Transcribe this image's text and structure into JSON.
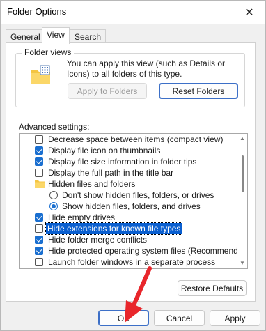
{
  "window": {
    "title": "Folder Options",
    "close_glyph": "✕"
  },
  "tabs": [
    {
      "label": "General",
      "active": false
    },
    {
      "label": "View",
      "active": true
    },
    {
      "label": "Search",
      "active": false
    }
  ],
  "folder_views": {
    "group_label": "Folder views",
    "description": "You can apply this view (such as Details or Icons) to all folders of this type.",
    "apply_button": "Apply to Folders",
    "reset_button": "Reset Folders"
  },
  "advanced": {
    "label": "Advanced settings:",
    "items": [
      {
        "type": "checkbox",
        "checked": false,
        "label": "Decrease space between items (compact view)"
      },
      {
        "type": "checkbox",
        "checked": true,
        "label": "Display file icon on thumbnails"
      },
      {
        "type": "checkbox",
        "checked": true,
        "label": "Display file size information in folder tips"
      },
      {
        "type": "checkbox",
        "checked": false,
        "label": "Display the full path in the title bar"
      },
      {
        "type": "folder",
        "label": "Hidden files and folders"
      },
      {
        "type": "radio",
        "checked": false,
        "label": "Don't show hidden files, folders, or drives"
      },
      {
        "type": "radio",
        "checked": true,
        "label": "Show hidden files, folders, and drives"
      },
      {
        "type": "checkbox",
        "checked": true,
        "label": "Hide empty drives"
      },
      {
        "type": "checkbox",
        "checked": false,
        "label": "Hide extensions for known file types",
        "selected": true
      },
      {
        "type": "checkbox",
        "checked": true,
        "label": "Hide folder merge conflicts"
      },
      {
        "type": "checkbox",
        "checked": true,
        "label": "Hide protected operating system files (Recommended)"
      },
      {
        "type": "checkbox",
        "checked": false,
        "label": "Launch folder windows in a separate process"
      }
    ],
    "restore_button": "Restore Defaults"
  },
  "footer": {
    "ok": "OK",
    "cancel": "Cancel",
    "apply": "Apply"
  },
  "colors": {
    "accent": "#1a6fd0",
    "annotation_arrow": "#e8262b"
  }
}
